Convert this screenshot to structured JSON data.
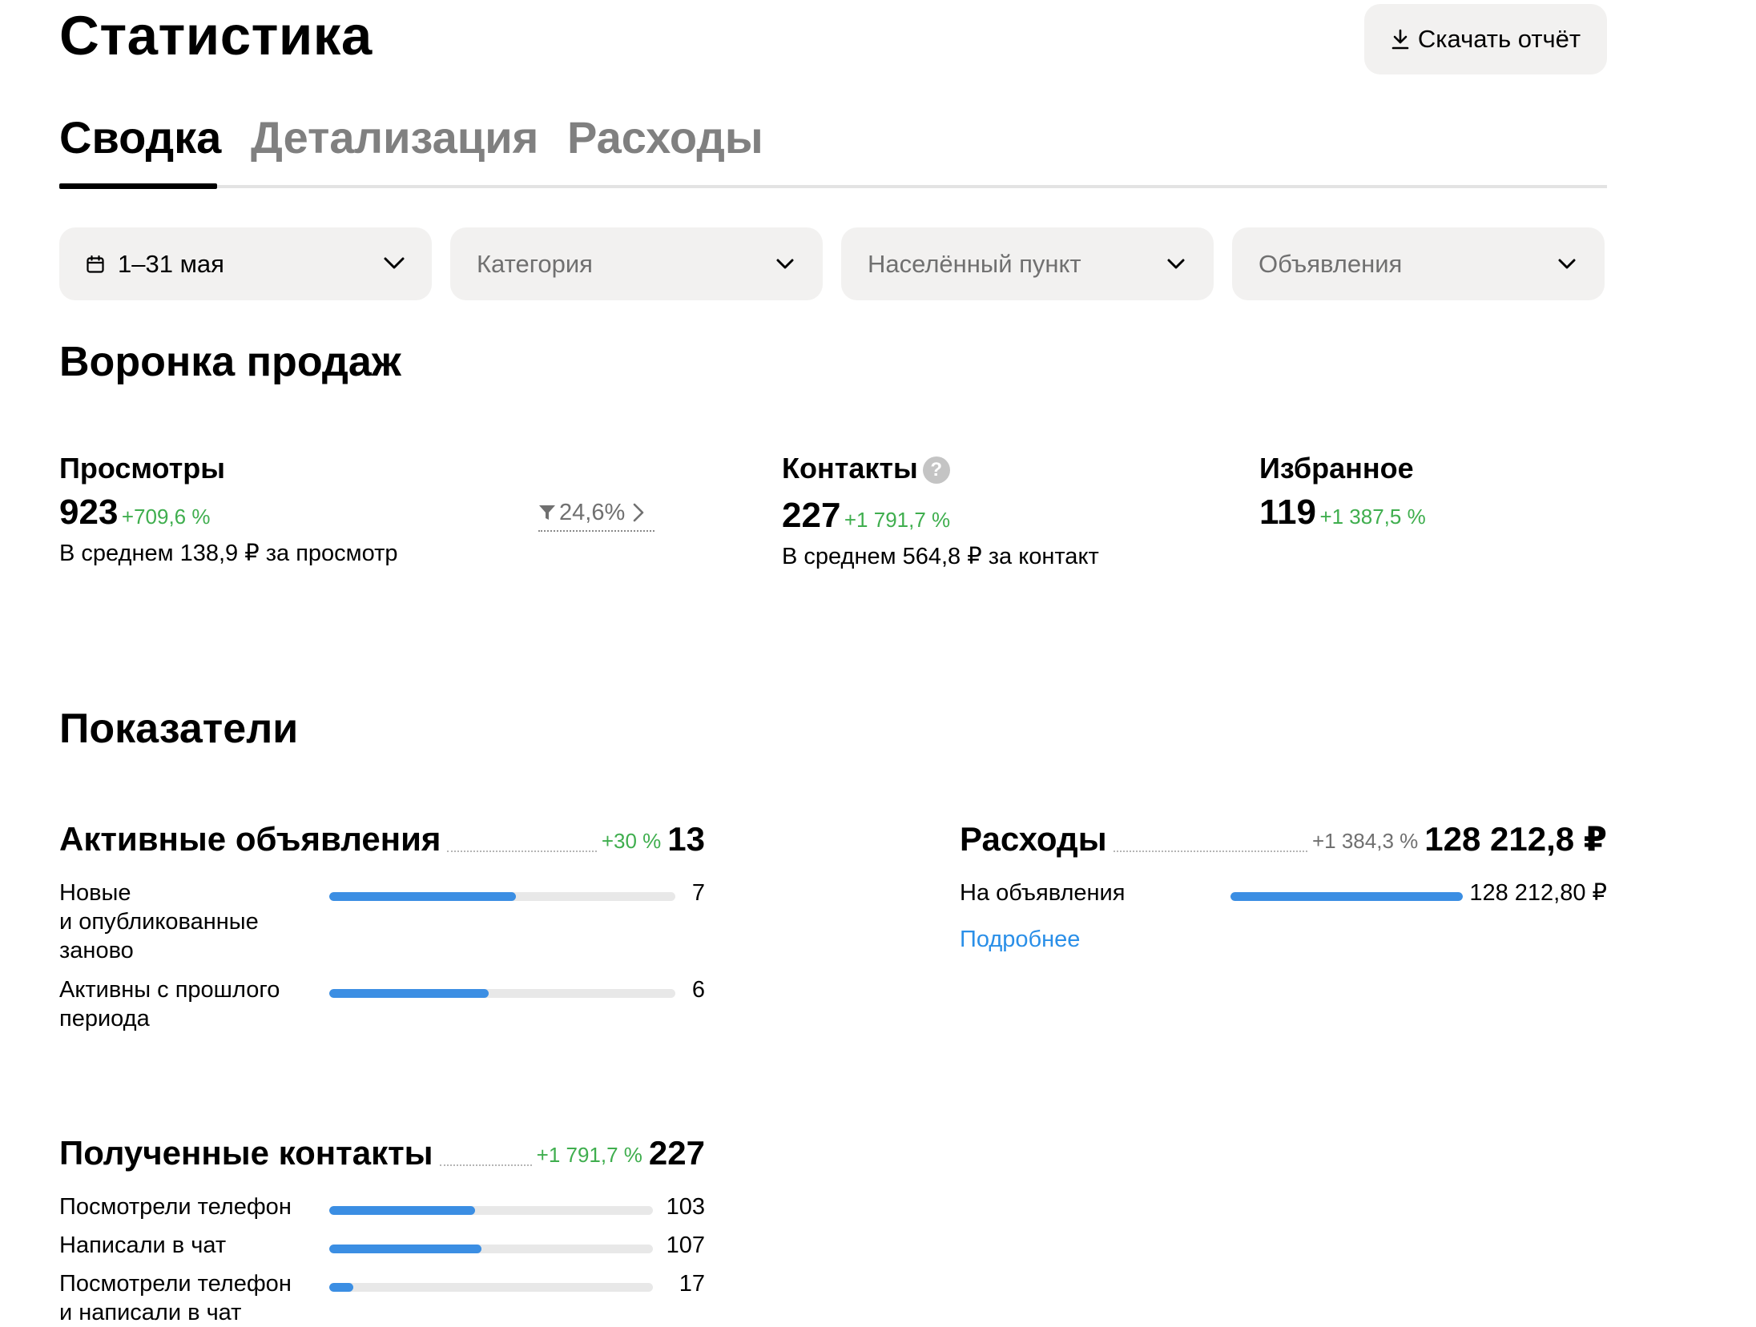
{
  "header": {
    "title": "Статистика",
    "download_label": "Скачать отчёт"
  },
  "tabs": [
    {
      "label": "Сводка",
      "active": true
    },
    {
      "label": "Детализация",
      "active": false
    },
    {
      "label": "Расходы",
      "active": false
    }
  ],
  "filters": {
    "period": "1–31 мая",
    "category": "Категория",
    "location": "Населённый пункт",
    "ads": "Объявления"
  },
  "funnel": {
    "title": "Воронка продаж",
    "views": {
      "label": "Просмотры",
      "value": "923",
      "change": "+709,6 %",
      "avg": "В среднем 138,9 ₽ за просмотр"
    },
    "conversion": "24,6%",
    "contacts": {
      "label": "Контакты",
      "help": "?",
      "value": "227",
      "change": "+1 791,7 %",
      "avg": "В среднем 564,8 ₽ за контакт"
    },
    "favorites": {
      "label": "Избранное",
      "value": "119",
      "change": "+1 387,5 %"
    }
  },
  "indicators": {
    "title": "Показатели",
    "active_ads": {
      "name": "Активные объявления",
      "change": "+30 %",
      "total": "13",
      "rows": [
        {
          "label_lines": [
            "Новые",
            "и опубликованные",
            "заново"
          ],
          "value": "7",
          "fraction": 0.54
        },
        {
          "label_lines": [
            "Активны с прошлого",
            "периода"
          ],
          "value": "6",
          "fraction": 0.46
        }
      ]
    },
    "expenses": {
      "name": "Расходы",
      "change": "+1 384,3 %",
      "total": "128 212,8 ₽",
      "rows": [
        {
          "label": "На объявления",
          "value": "128 212,80 ₽",
          "fraction": 1.0
        }
      ],
      "more_link": "Подробнее"
    },
    "contacts": {
      "name": "Полученные контакты",
      "change": "+1 791,7 %",
      "total": "227",
      "rows": [
        {
          "label_lines": [
            "Посмотрели телефон"
          ],
          "value": "103",
          "fraction": 0.45
        },
        {
          "label_lines": [
            "Написали в чат"
          ],
          "value": "107",
          "fraction": 0.47
        },
        {
          "label_lines": [
            "Посмотрели телефон",
            "и написали в чат"
          ],
          "value": "17",
          "fraction": 0.075
        }
      ]
    }
  },
  "colors": {
    "accent_blue": "#3b8ee3",
    "positive_green": "#3fae4e",
    "filter_bg": "#f2f1f0"
  }
}
